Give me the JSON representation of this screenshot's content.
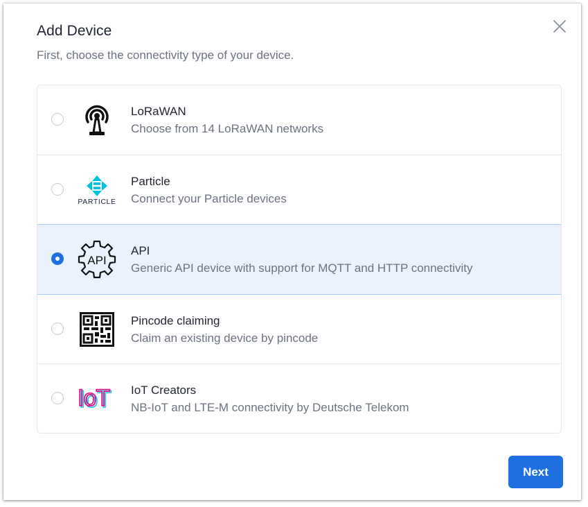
{
  "dialog": {
    "title": "Add Device",
    "subtitle": "First, choose the connectivity type of your device.",
    "close_icon": "close-icon",
    "next_label": "Next"
  },
  "options": [
    {
      "id": "lorawan",
      "title": "LoRaWAN",
      "description": "Choose from 14 LoRaWAN networks",
      "icon": "antenna-icon",
      "selected": false
    },
    {
      "id": "particle",
      "title": "Particle",
      "description": "Connect your Particle devices",
      "icon": "particle-logo",
      "logo_text": "PARTICLE",
      "selected": false
    },
    {
      "id": "api",
      "title": "API",
      "description": "Generic API device with support for MQTT and HTTP connectivity",
      "icon": "api-gear-icon",
      "icon_text": "API",
      "selected": true
    },
    {
      "id": "pincode",
      "title": "Pincode claiming",
      "description": "Claim an existing device by pincode",
      "icon": "qr-code-icon",
      "selected": false
    },
    {
      "id": "iot-creators",
      "title": "IoT Creators",
      "description": "NB-IoT and LTE-M connectivity by Deutsche Telekom",
      "icon": "iot-creators-logo",
      "logo_text": "IoT",
      "selected": false
    }
  ],
  "colors": {
    "primary": "#1f6fe0",
    "selected_bg": "#eaf3fd",
    "selected_border": "#a9cdf5",
    "particle_cyan": "#00c2e0",
    "iot_pink": "#e4007c",
    "iot_cyan": "#22c5e8"
  }
}
